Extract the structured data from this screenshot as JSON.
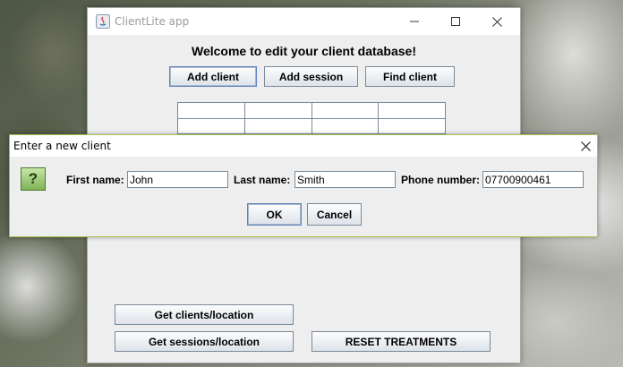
{
  "main_window": {
    "title": "ClientLite app",
    "welcome": "Welcome to edit your client database!",
    "buttons": {
      "add_client": "Add client",
      "add_session": "Add session",
      "find_client": "Find client",
      "get_clients": "Get clients/location",
      "get_sessions": "Get sessions/location",
      "reset": "RESET TREATMENTS"
    }
  },
  "dialog": {
    "title": "Enter a new client",
    "icon_glyph": "?",
    "first_name_label": "First name:",
    "first_name_value": "John",
    "last_name_label": "Last name:",
    "last_name_value": "Smith",
    "phone_label": "Phone number:",
    "phone_value": "07700900461",
    "ok": "OK",
    "cancel": "Cancel"
  }
}
